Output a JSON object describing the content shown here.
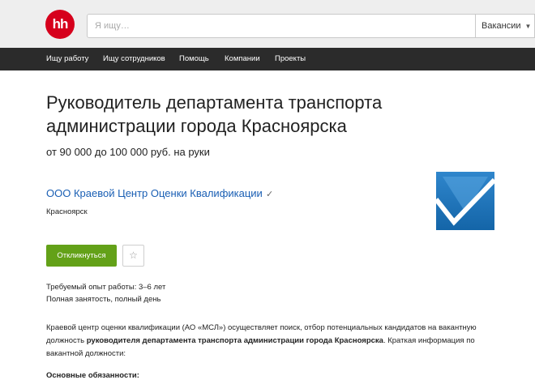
{
  "header": {
    "logo_text": "hh",
    "search_placeholder": "Я ищу…",
    "search_scope": "Вакансии"
  },
  "nav": {
    "items": [
      {
        "label": "Ищу работу"
      },
      {
        "label": "Ищу сотрудников"
      },
      {
        "label": "Помощь"
      },
      {
        "label": "Компании"
      },
      {
        "label": "Проекты"
      }
    ]
  },
  "vacancy": {
    "title": "Руководитель департамента транспорта администрации города Красноярска",
    "salary": "от 90 000 до 100 000 руб. на руки",
    "company": "ООО Краевой Центр Оценки Квалификации",
    "city": "Красноярск",
    "apply_label": "Откликнуться",
    "experience": "Требуемый опыт работы: 3–6 лет",
    "employment": "Полная занятость, полный день",
    "desc_part1": "Краевой центр оценки квалификации (АО «МСЛ») осуществляет поиск, отбор потенциальных кандидатов на вакантную должность ",
    "desc_bold": "руководителя департамента транспорта администрации города Красноярска",
    "desc_part2": ". Краткая информация по вакантной должности:",
    "duties_title": "Основные обязанности:"
  },
  "colors": {
    "brand": "#d6001c",
    "nav_bg": "#2b2b2b",
    "link": "#1a5fb4",
    "apply": "#63a118"
  }
}
